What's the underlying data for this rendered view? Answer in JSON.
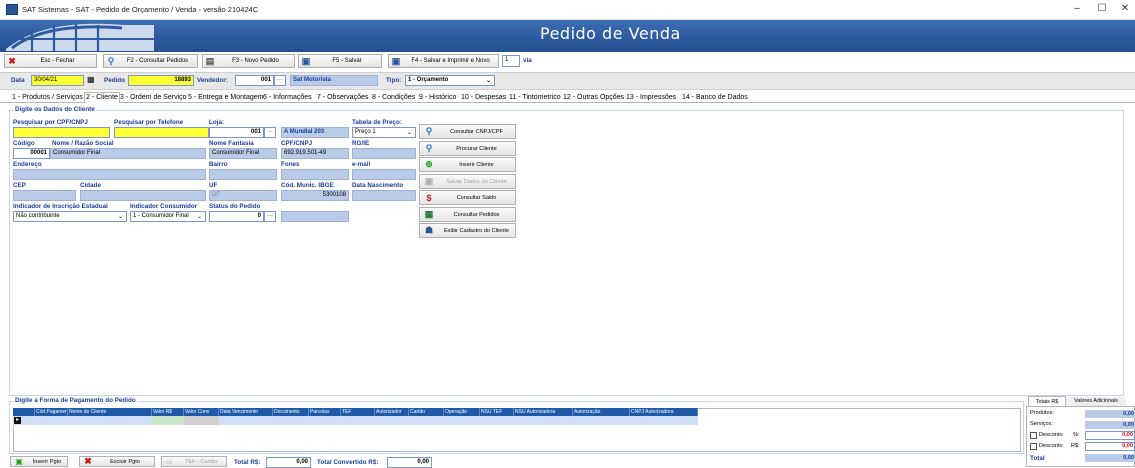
{
  "window": {
    "title": "SAT Sistemas - SAT - Pedido de Orçamento / Venda - versão 210424C",
    "minimize": "–",
    "maximize": "☐",
    "close": "✕"
  },
  "banner": {
    "title": "Pedido de Venda"
  },
  "toolbar": {
    "esc": "Esc - Fechar",
    "f2": "F2 - Consultar Pedidos",
    "f3": "F3 - Novo Pedido",
    "f5": "F5 - Salvar",
    "f4": "F4 - Salvar e Imprimir e Novo",
    "copies": "1",
    "via": "via"
  },
  "header": {
    "data_label": "Data",
    "data_value": "30/04/21",
    "pedido_label": "Pedido",
    "pedido_value": "18893",
    "vendedor_label": "Vendedor:",
    "vendedor_code": "001",
    "vendedor_name": "Sat Motorista",
    "tipo_label": "Tipo:",
    "tipo_value": "1 - Orçamento"
  },
  "tabs": [
    "1 - Produtos / Serviços",
    "2 - Cliente",
    "3 - Ordem de Serviço",
    "5 - Entrega e Montagem",
    "6 - Informações",
    "7 - Observações",
    "8 - Condições",
    "9 - Histórico",
    "10 - Despesas",
    "11 - Tintometrico",
    "12 - Outras Opções",
    "13 - Impressões",
    "14 - Banco de Dados"
  ],
  "client": {
    "group_title": "Digite os Dados do Cliente",
    "search_cpf_label": "Pesquisar por CPF/CNPJ",
    "search_tel_label": "Pesquisar por Telefone",
    "loja_label": "Loja:",
    "loja_code": "001",
    "loja_name": "A Mundial 203",
    "tabela_label": "Tabela de Preço:",
    "tabela_value": "Preço 1",
    "codigo_label": "Código",
    "codigo_value": "00001",
    "nome_label": "Nome / Razão Social",
    "nome_value": "Consumidor Final",
    "fantasia_label": "Nome Fantasia",
    "fantasia_value": "Consumidor Final",
    "cpf_label": "CPF/CNPJ",
    "cpf_value": "692.919.501-49",
    "rg_label": "RG/IE",
    "endereco_label": "Endereço",
    "bairro_label": "Bairro",
    "fones_label": "Fones",
    "email_label": "e-mail",
    "cep_label": "CEP",
    "cidade_label": "Cidade",
    "uf_label": "UF",
    "uf_value": "DF",
    "ibge_label": "Cód. Munic. IBGE",
    "ibge_value": "5300108",
    "nasc_label": "Data Nascimento",
    "ind_ie_label": "Indicador de Inscrição Estadual",
    "ind_ie_value": "Não contribuinte",
    "ind_cons_label": "Indicador Consumidor",
    "ind_cons_value": "1 - Consumidor Final",
    "status_label": "Status do Pedido",
    "status_value": "0"
  },
  "side_buttons": [
    "Consultar CNPJ/CPF",
    "Procurar Cliente",
    "Inserir Cliente",
    "Salvar Dados do Cliente",
    "Consultar Saldo",
    "Consultar Pedidos",
    "Exibir Cadastro do Cliente"
  ],
  "payment": {
    "group_title": "Digite a Forma de Pagamento do Pedido",
    "columns": [
      "Cód Pagamento",
      "Nome do Cliente",
      "Valor R$",
      "Valor Conv",
      "Data Vencimento",
      "Documento",
      "Parcelas",
      "TEF",
      "Autorizador",
      "Cartão",
      "Operação",
      "NSU TEF",
      "NSU Autorizadora",
      "Autorização",
      "CNPJ Autorizadora"
    ]
  },
  "bottom": {
    "inserir": "Inserir Pgto",
    "excluir": "Excluir Pgto",
    "tef": "TEF - Cartão",
    "total_label": "Total R$:",
    "total_value": "0,00",
    "conv_label": "Total Convertido R$:",
    "conv_value": "0,00"
  },
  "totals": {
    "tab1": "Totais R$",
    "tab2": "Valores Adicionais",
    "produtos_label": "Produtos:",
    "produtos_value": "0,00",
    "servicos_label": "Serviços:",
    "servicos_value": "0,00",
    "desc_pct_label": "Desconto",
    "desc_pct_unit": "%:",
    "desc_pct_value": "0,00",
    "desc_rs_label": "Desconto",
    "desc_rs_unit": "R$:",
    "desc_rs_value": "0,00",
    "total_label": "Total",
    "total_value": "0,00"
  },
  "colors": {
    "banner": "#2d5aa0",
    "label_blue": "#1a3e9a",
    "yellow": "#ffff33",
    "grid_header": "#1f5aa8"
  }
}
